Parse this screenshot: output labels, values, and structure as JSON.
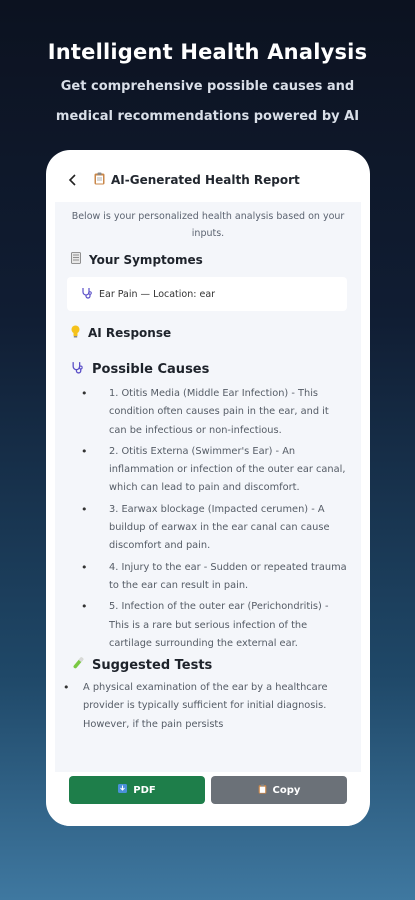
{
  "hero": {
    "title": "Intelligent Health Analysis",
    "subtitle": "Get comprehensive possible causes and medical recommendations powered by AI"
  },
  "report": {
    "title": "AI-Generated Health Report",
    "title_icon": "clipboard-icon",
    "intro": "Below is your personalized health analysis based on your inputs.",
    "symptoms_heading": "Your Symptomes",
    "symptom_entry": "Ear Pain — Location: ear",
    "ai_response_heading": "AI Response",
    "causes_heading": "Possible Causes",
    "causes": [
      "1. Otitis Media (Middle Ear Infection) - This condition often causes pain in the ear, and it can be infectious or non-infectious.",
      "2. Otitis Externa (Swimmer's Ear) - An inflammation or infection of the outer ear canal, which can lead to pain and discomfort.",
      "3. Earwax blockage (Impacted cerumen) - A buildup of earwax in the ear canal can cause discomfort and pain.",
      "4. Injury to the ear - Sudden or repeated trauma to the ear can result in pain.",
      "5. Infection of the outer ear (Perichondritis) - This is a rare but serious infection of the cartilage surrounding the external ear."
    ],
    "tests_heading": "Suggested Tests",
    "tests": [
      "A physical examination of the ear by a healthcare provider is typically sufficient for initial diagnosis. However, if the pain persists"
    ]
  },
  "actions": {
    "pdf_label": "PDF",
    "copy_label": "Copy"
  },
  "colors": {
    "pdf_button": "#1e7e4a",
    "copy_button": "#6b7178"
  }
}
